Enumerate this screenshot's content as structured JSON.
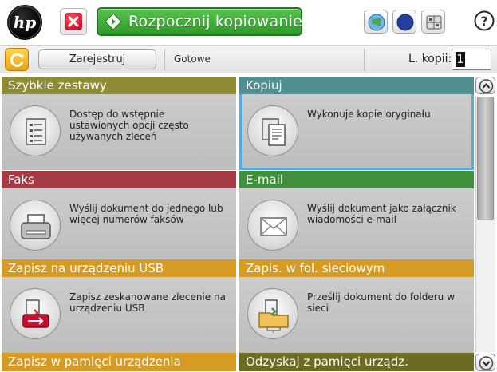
{
  "topbar": {
    "logo_icon": "hp-logo-icon",
    "stop_icon": "stop-icon",
    "start_label": "Rozpocznij kopiowanie",
    "start_icon": "start-diamond-icon",
    "buttons": [
      {
        "name": "network-icon"
      },
      {
        "name": "sleep-icon"
      },
      {
        "name": "language-icon"
      }
    ],
    "help_icon": "help-icon"
  },
  "status": {
    "refresh_icon": "refresh-icon",
    "signin_label": "Zarejestruj",
    "status_text": "Gotowe",
    "copies_label": "L. kopii:",
    "copies_value": "1"
  },
  "tiles": [
    {
      "title": "Szybkie zestawy",
      "desc": "Dostęp do wstępnie ustawionych opcji często używanych zleceń",
      "icon": "quick-sets-icon",
      "color": "#8d8b35"
    },
    {
      "title": "Kopiuj",
      "desc": "Wykonuje kopie oryginału",
      "icon": "copy-icon",
      "color": "#4f8f91"
    },
    {
      "title": "Faks",
      "desc": "Wyślij dokument do jednego lub więcej numerów faksów",
      "icon": "fax-icon",
      "color": "#a63b43"
    },
    {
      "title": "E-mail",
      "desc": "Wyślij dokument jako załącznik wiadomości e-mail",
      "icon": "email-icon",
      "color": "#3f8f3c"
    },
    {
      "title": "Zapisz na urządzeniu USB",
      "desc": "Zapisz zeskanowane zlecenie na urządzeniu USB",
      "icon": "usb-icon",
      "color": "#d59b24"
    },
    {
      "title": "Zapis. w fol. sieciowym",
      "desc": "Prześlij dokument do folderu w sieci",
      "icon": "network-folder-icon",
      "color": "#d59b24"
    }
  ],
  "bottom": [
    {
      "title": "Zapisz w pamięci urządzenia",
      "color": "#d59b24"
    },
    {
      "title": "Odzyskaj z pamięci urządz.",
      "color": "#6b6c22"
    }
  ],
  "scroll": {
    "up_icon": "scroll-up-icon",
    "down_icon": "scroll-down-icon"
  }
}
